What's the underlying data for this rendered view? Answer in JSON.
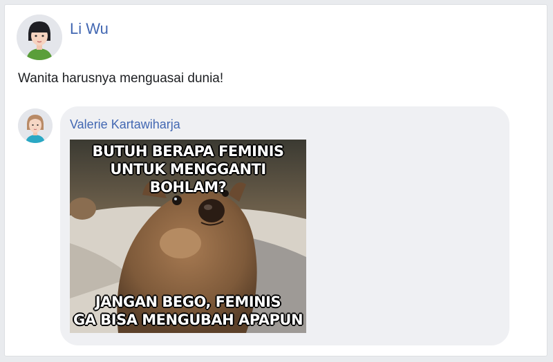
{
  "post": {
    "author": "Li Wu",
    "text": "Wanita harusnya menguasai dunia!",
    "avatar_icon": "woman-avatar-icon"
  },
  "comment": {
    "author": "Valerie Kartawiharja",
    "avatar_icon": "woman-avatar-icon",
    "meme": {
      "top_line_1": "BUTUH BERAPA FEMINIS",
      "top_line_2": "UNTUK MENGGANTI BOHLAM?",
      "bottom_line_1": "JANGAN BEGO, FEMINIS",
      "bottom_line_2": "GA BISA MENGUBAH APAPUN"
    }
  },
  "colors": {
    "link": "#4267b2",
    "bubble": "#eff0f3"
  }
}
